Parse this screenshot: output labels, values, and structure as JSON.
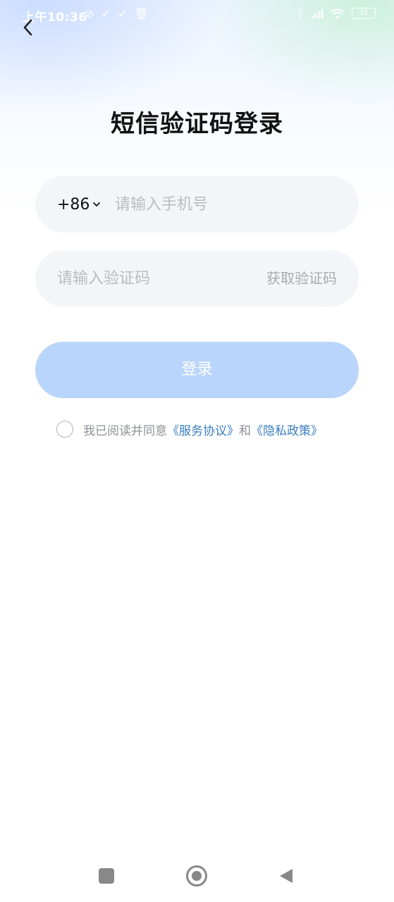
{
  "status_bar": {
    "time": "上午10:36",
    "icons_left": [
      "mute-icon",
      "check-icon",
      "check-icon",
      "trash-icon"
    ],
    "icons_right": [
      "bluetooth-icon",
      "signal-icon",
      "wifi-icon"
    ],
    "battery": "35"
  },
  "page": {
    "title": "短信验证码登录"
  },
  "phone_field": {
    "country_code": "+86",
    "placeholder": "请输入手机号"
  },
  "code_field": {
    "placeholder": "请输入验证码",
    "get_code_label": "获取验证码"
  },
  "login_button": {
    "label": "登录"
  },
  "agreement": {
    "prefix": "我已阅读并同意",
    "service_link": "《服务协议》",
    "conjunction": "和",
    "privacy_link": "《隐私政策》",
    "checked": false
  },
  "colors": {
    "primary_disabled": "#b9d5fb",
    "link": "#3a7fc0",
    "field_bg": "#f4f5f8"
  }
}
